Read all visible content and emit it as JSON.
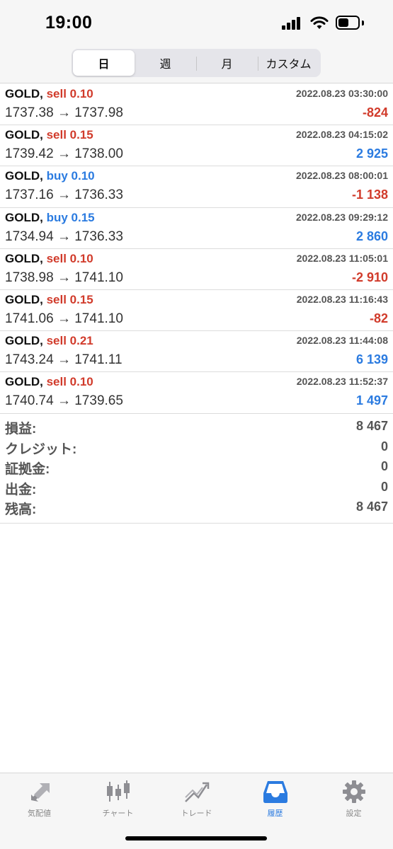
{
  "status_bar": {
    "time": "19:00"
  },
  "period_tabs": [
    {
      "label": "日",
      "active": true
    },
    {
      "label": "週",
      "active": false
    },
    {
      "label": "月",
      "active": false
    },
    {
      "label": "カスタム",
      "active": false
    }
  ],
  "trades": [
    {
      "symbol": "GOLD,",
      "side": "sell 0.10",
      "direction": "sell",
      "time": "2022.08.23 03:30:00",
      "prices": "1737.38 → 1737.98",
      "profit": "-824",
      "profit_sign": "neg"
    },
    {
      "symbol": "GOLD,",
      "side": "sell 0.15",
      "direction": "sell",
      "time": "2022.08.23 04:15:02",
      "prices": "1739.42 → 1738.00",
      "profit": "2 925",
      "profit_sign": "pos"
    },
    {
      "symbol": "GOLD,",
      "side": "buy 0.10",
      "direction": "buy",
      "time": "2022.08.23 08:00:01",
      "prices": "1737.16 → 1736.33",
      "profit": "-1 138",
      "profit_sign": "neg"
    },
    {
      "symbol": "GOLD,",
      "side": "buy 0.15",
      "direction": "buy",
      "time": "2022.08.23 09:29:12",
      "prices": "1734.94 → 1736.33",
      "profit": "2 860",
      "profit_sign": "pos"
    },
    {
      "symbol": "GOLD,",
      "side": "sell 0.10",
      "direction": "sell",
      "time": "2022.08.23 11:05:01",
      "prices": "1738.98 → 1741.10",
      "profit": "-2 910",
      "profit_sign": "neg"
    },
    {
      "symbol": "GOLD,",
      "side": "sell 0.15",
      "direction": "sell",
      "time": "2022.08.23 11:16:43",
      "prices": "1741.06 → 1741.10",
      "profit": "-82",
      "profit_sign": "neg"
    },
    {
      "symbol": "GOLD,",
      "side": "sell 0.21",
      "direction": "sell",
      "time": "2022.08.23 11:44:08",
      "prices": "1743.24 → 1741.11",
      "profit": "6 139",
      "profit_sign": "pos"
    },
    {
      "symbol": "GOLD,",
      "side": "sell 0.10",
      "direction": "sell",
      "time": "2022.08.23 11:52:37",
      "prices": "1740.74 → 1739.65",
      "profit": "1 497",
      "profit_sign": "pos"
    }
  ],
  "summary": [
    {
      "label": "損益:",
      "value": "8 467"
    },
    {
      "label": "クレジット:",
      "value": "0"
    },
    {
      "label": "証拠金:",
      "value": "0"
    },
    {
      "label": "出金:",
      "value": "0"
    },
    {
      "label": "残高:",
      "value": "8 467"
    }
  ],
  "bottom_tabs": [
    {
      "label": "気配値",
      "icon": "quotes-icon",
      "active": false
    },
    {
      "label": "チャート",
      "icon": "candlestick-chart-icon",
      "active": false
    },
    {
      "label": "トレード",
      "icon": "trade-chart-icon",
      "active": false
    },
    {
      "label": "履歴",
      "icon": "history-inbox-icon",
      "active": true
    },
    {
      "label": "設定",
      "icon": "gear-icon",
      "active": false
    }
  ],
  "colors": {
    "sell": "#d13b2b",
    "buy": "#2b7be0",
    "negative": "#d13b2b",
    "positive": "#2b7be0",
    "accent": "#2b7be0",
    "inactive_icon": "#8e8e93"
  }
}
